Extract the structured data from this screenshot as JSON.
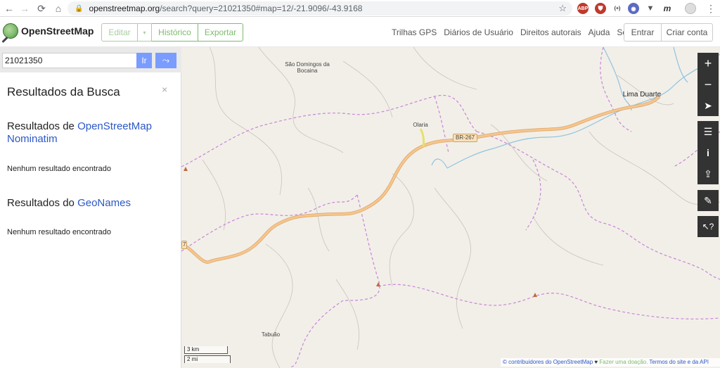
{
  "browser": {
    "url_host": "openstreetmap.org",
    "url_rest": "/search?query=21021350#map=12/-21.9096/-43.9168",
    "extensions": [
      "ABP",
      "(+)",
      "m"
    ]
  },
  "header": {
    "logo": "OpenStreetMap",
    "edit_label": "Editar",
    "history_label": "Histórico",
    "export_label": "Exportar",
    "links": [
      "Trilhas GPS",
      "Diários de Usuário",
      "Direitos autorais",
      "Ajuda",
      "Sobre"
    ],
    "login_label": "Entrar",
    "signup_label": "Criar conta"
  },
  "sidebar": {
    "search_value": "21021350",
    "go_label": "Ir",
    "results_title": "Resultados da Busca",
    "close_label": "×",
    "sections": [
      {
        "prefix": "Resultados de ",
        "link": "OpenStreetMap Nominatim",
        "empty": "Nenhum resultado encontrado"
      },
      {
        "prefix": "Resultados do ",
        "link": "GeoNames",
        "empty": "Nenhum resultado encontrado"
      }
    ]
  },
  "map": {
    "places": [
      "São Domingos da Bocaina",
      "Olaria",
      "Lima Duarte",
      "Tabuão"
    ],
    "road_shields": [
      "BR-267",
      "7"
    ],
    "scale_km": "3 km",
    "scale_mi": "2 mi",
    "attribution": {
      "copyright": "© contribuidores do OpenStreetMap",
      "heart": "♥",
      "donate": "Fazer uma doação.",
      "terms": "Termos do site e da API"
    }
  },
  "colors": {
    "osm_green": "#7ebc6f",
    "link_blue": "#2c57c6",
    "search_blue": "#7a9cff",
    "map_bg": "#f2efe9",
    "road_orange": "#f7c58c",
    "boundary": "#b67ad0",
    "river": "#6fb4d6"
  }
}
